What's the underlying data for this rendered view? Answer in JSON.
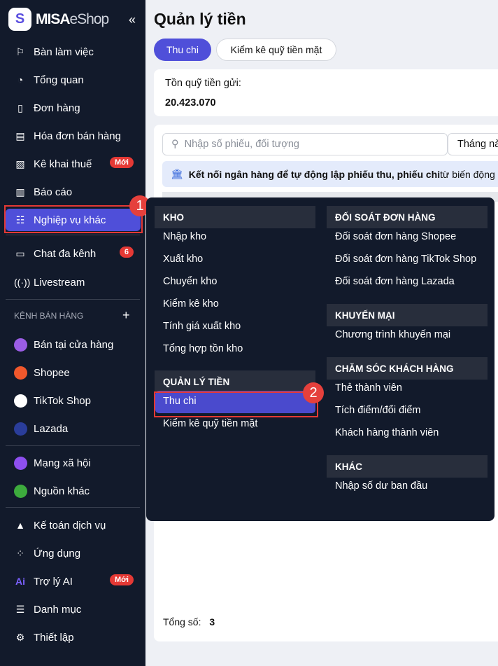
{
  "sidebar": {
    "brand_main": "MISA",
    "brand_sub": "eShop",
    "collapse": "«",
    "items": [
      {
        "label": "Bàn làm việc",
        "icon": "desk-icon"
      },
      {
        "label": "Tổng quan",
        "icon": "dashboard-icon"
      },
      {
        "label": "Đơn hàng",
        "icon": "order-icon"
      },
      {
        "label": "Hóa đơn bán hàng",
        "icon": "invoice-icon"
      },
      {
        "label": "Kê khai thuế",
        "icon": "tax-icon",
        "badge": "Mới"
      },
      {
        "label": "Báo cáo",
        "icon": "report-icon"
      },
      {
        "label": "Nghiệp vụ khác",
        "icon": "list-icon",
        "active": true
      },
      {
        "label": "Chat đa kênh",
        "icon": "chat-icon",
        "badge": "6"
      },
      {
        "label": "Livestream",
        "icon": "livestream-icon"
      }
    ],
    "channels_title": "KÊNH BÁN HÀNG",
    "add": "+",
    "channels": [
      {
        "label": "Bán tại cửa hàng",
        "color": "#9b5de5"
      },
      {
        "label": "Shopee",
        "color": "#f1582c"
      },
      {
        "label": "TikTok Shop",
        "color": "#ffffff"
      },
      {
        "label": "Lazada",
        "color": "#2a3d9a"
      }
    ],
    "others": [
      {
        "label": "Mạng xã hội",
        "color": "#8e4ff0"
      },
      {
        "label": "Nguồn khác",
        "color": "#3dab3d"
      }
    ],
    "bottom": [
      {
        "label": "Kế toán dịch vụ",
        "icon": "accounting-icon"
      },
      {
        "label": "Ứng dụng",
        "icon": "apps-icon"
      },
      {
        "label": "Trợ lý AI",
        "icon": "ai-icon",
        "badge": "Mới"
      },
      {
        "label": "Danh mục",
        "icon": "catalog-icon"
      },
      {
        "label": "Thiết lập",
        "icon": "gear-icon"
      }
    ]
  },
  "main": {
    "title": "Quản lý tiền",
    "tabs": [
      "Thu chi",
      "Kiểm kê quỹ tiền mặt"
    ],
    "balance_label": "Tồn quỹ tiền gửi:",
    "balance_value": "20.423.070",
    "search_placeholder": "Nhập số phiếu, đối tượng",
    "period": "Tháng này",
    "bank_bold": "Kết nối ngân hàng để tự động lập phiếu thu, phiếu chi",
    "bank_rest": " từ biến động số dư",
    "total_label": "Tổng số:",
    "total_value": "3"
  },
  "popup": {
    "col1": [
      {
        "title": "KHO",
        "items": [
          "Nhập kho",
          "Xuất kho",
          "Chuyển kho",
          "Kiểm kê kho",
          "Tính giá xuất kho",
          "Tổng hợp tồn kho"
        ]
      },
      {
        "title": "QUẢN LÝ TIỀN",
        "items": [
          "Thu chi",
          "Kiểm kê quỹ tiền mặt"
        ]
      }
    ],
    "col2": [
      {
        "title": "ĐỐI SOÁT ĐƠN HÀNG",
        "items": [
          "Đối soát đơn hàng Shopee",
          "Đối soát đơn hàng TikTok Shop",
          "Đối soát đơn hàng Lazada"
        ]
      },
      {
        "title": "KHUYẾN MẠI",
        "items": [
          "Chương trình khuyến mại"
        ]
      },
      {
        "title": "CHĂM SÓC KHÁCH HÀNG",
        "items": [
          "Thẻ thành viên",
          "Tích điểm/đổi điểm",
          "Khách hàng thành viên"
        ]
      },
      {
        "title": "KHÁC",
        "items": [
          "Nhập số dư ban đầu"
        ]
      }
    ]
  },
  "steps": [
    "1",
    "2"
  ],
  "colors": {
    "accent": "#4f4fd9",
    "sidebar": "#121a2b",
    "highlight": "#e53935"
  }
}
